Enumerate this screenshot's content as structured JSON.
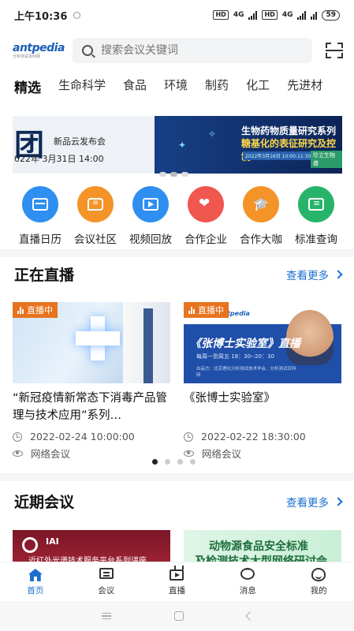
{
  "status_bar": {
    "time": "上午10:36",
    "net1": "4G",
    "net2": "4G",
    "battery": "59"
  },
  "header": {
    "logo_main": "antpedia",
    "logo_sub": "分析测试百科网",
    "search_placeholder": "搜索会议关键词"
  },
  "tabs": [
    {
      "label": "精选",
      "active": true
    },
    {
      "label": "生命科学"
    },
    {
      "label": "食品"
    },
    {
      "label": "环境"
    },
    {
      "label": "制药"
    },
    {
      "label": "化工"
    },
    {
      "label": "先进材"
    }
  ],
  "banner": {
    "left_big": "团",
    "left_title": "新品云发布会",
    "left_date": "022年 3月31日 14:00",
    "right_title_1": "生物药物质量研究系列",
    "right_title_2": "糖基化的表征研究及控制",
    "right_date": "2022年3月16日 10:00-11:30",
    "right_tag": "珍立生物盛"
  },
  "quick_actions": [
    {
      "label": "直播日历",
      "icon": "calendar-icon",
      "color": "#2f8ff0"
    },
    {
      "label": "会议社区",
      "icon": "chat-icon",
      "color": "#f39328"
    },
    {
      "label": "视频回放",
      "icon": "video-icon",
      "color": "#2f8ff0"
    },
    {
      "label": "合作企业",
      "icon": "heart-handshake-icon",
      "color": "#f0574f"
    },
    {
      "label": "合作大咖",
      "icon": "graduation-cap-icon",
      "color": "#f39328"
    },
    {
      "label": "标准查询",
      "icon": "document-icon",
      "color": "#27b36a"
    }
  ],
  "live_section": {
    "title": "正在直播",
    "more": "查看更多",
    "items": [
      {
        "badge": "直播中",
        "title": "“新冠疫情新常态下消毒产品管理与技术应用”系列…",
        "time": "2022-02-24 10:00:00",
        "type": "网络会议"
      },
      {
        "badge": "直播中",
        "thumb_brand": "antpedia",
        "thumb_title": "《张博士实验室》直播",
        "thumb_sub": "每周一到周五 18：30--20：30",
        "thumb_org": "出品方：北京理化分析测试技术学会、分析测试百科网",
        "title": "《张博士实验室》",
        "time": "2022-02-22 18:30:00",
        "type": "网络会议"
      }
    ]
  },
  "upcoming_section": {
    "title": "近期会议",
    "more": "查看更多",
    "items": [
      {
        "logo": "IAI",
        "text": "近红外光谱技术服务平台系列讲座"
      },
      {
        "line1": "动物源食品安全标准",
        "line2": "及检测技术大型网络研讨会"
      }
    ]
  },
  "bottom_nav": [
    {
      "label": "首页",
      "icon": "home-icon",
      "active": true
    },
    {
      "label": "会议",
      "icon": "meeting-icon"
    },
    {
      "label": "直播",
      "icon": "live-tv-icon"
    },
    {
      "label": "消息",
      "icon": "message-icon"
    },
    {
      "label": "我的",
      "icon": "profile-icon"
    }
  ]
}
